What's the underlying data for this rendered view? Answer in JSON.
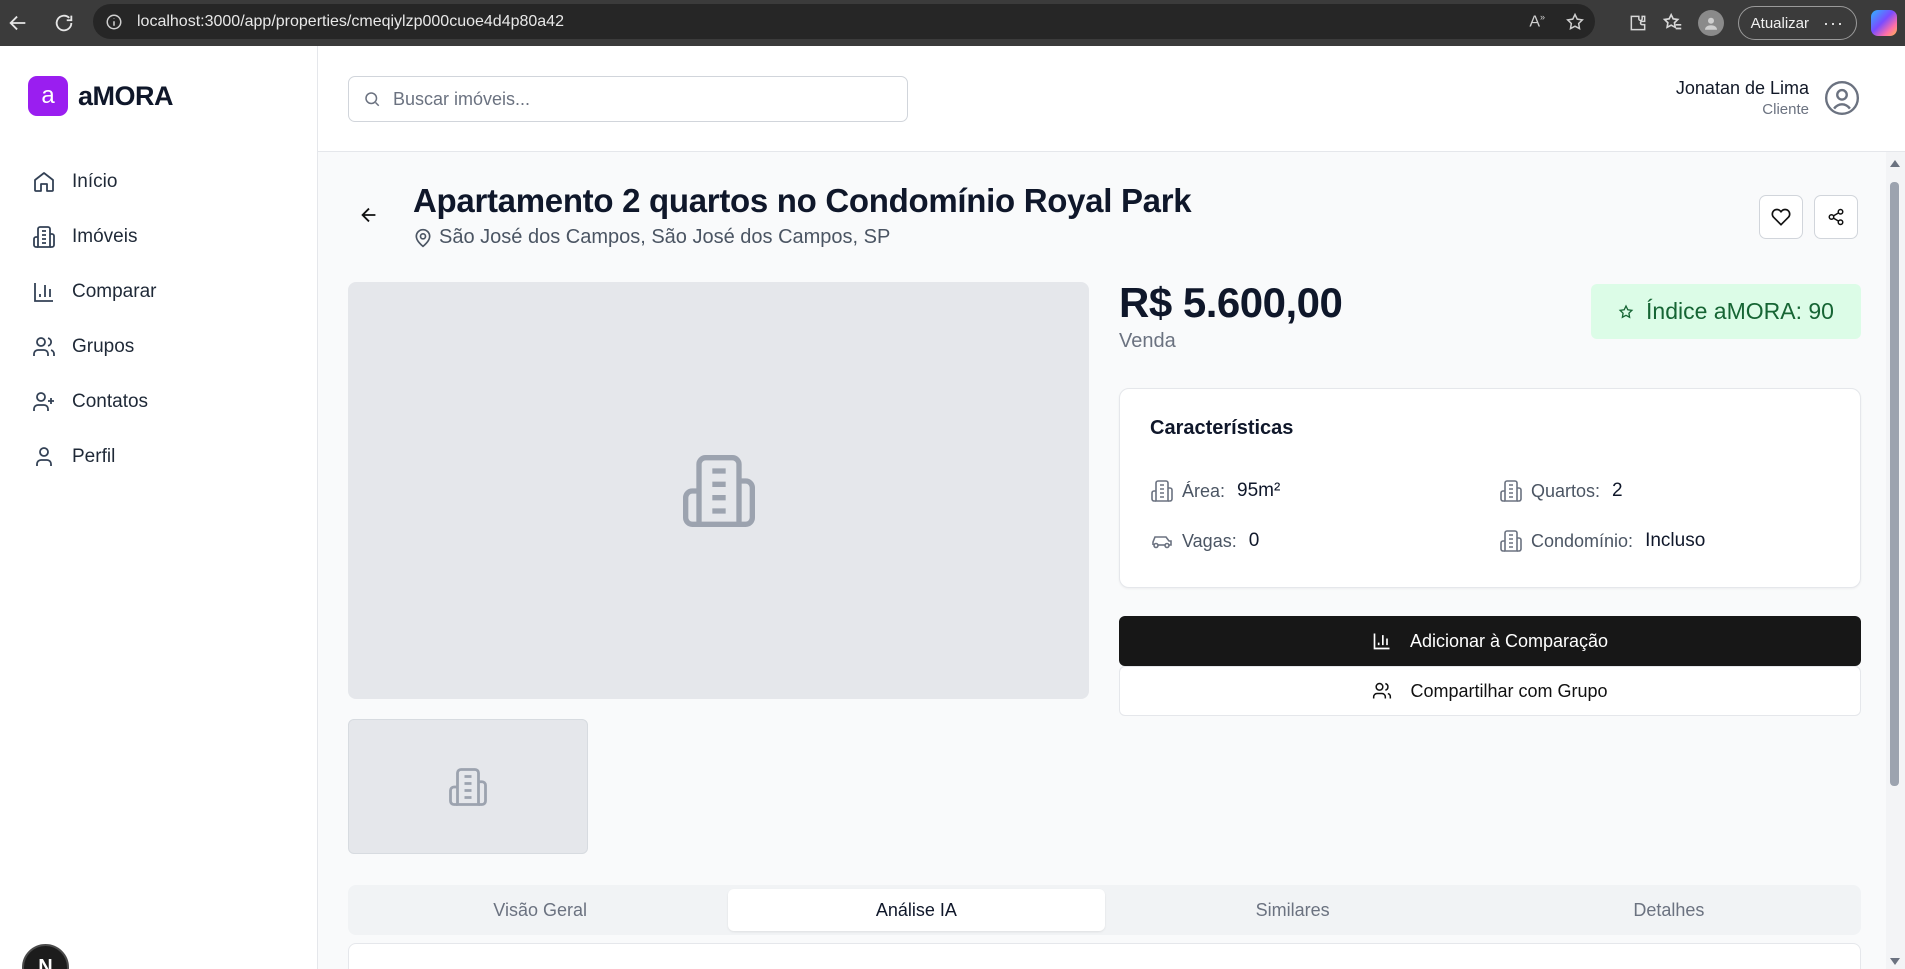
{
  "browser": {
    "url": "localhost:3000/app/properties/cmeqiylzp000cuoe4d4p80a42",
    "update_label": "Atualizar"
  },
  "brand": {
    "logo_letter": "a",
    "name": "aMORA",
    "accent": "#9a1ef0"
  },
  "sidebar": {
    "items": [
      {
        "label": "Início",
        "icon": "home-icon"
      },
      {
        "label": "Imóveis",
        "icon": "building-icon"
      },
      {
        "label": "Comparar",
        "icon": "bar-chart-icon"
      },
      {
        "label": "Grupos",
        "icon": "users-icon"
      },
      {
        "label": "Contatos",
        "icon": "user-plus-icon"
      },
      {
        "label": "Perfil",
        "icon": "user-icon"
      }
    ],
    "dev_badge": "N"
  },
  "search": {
    "placeholder": "Buscar imóveis..."
  },
  "user": {
    "name": "Jonatan de Lima",
    "role": "Cliente"
  },
  "property": {
    "title": "Apartamento 2 quartos no Condomínio Royal Park",
    "location": "São José dos Campos, São José dos Campos, SP",
    "price": "R$ 5.600,00",
    "deal_type": "Venda",
    "score_label": "Índice aMORA: 90",
    "score_color": "#dcfce7"
  },
  "features": {
    "title": "Características",
    "items": [
      {
        "label": "Área:",
        "value": "95m²",
        "icon": "building-icon"
      },
      {
        "label": "Quartos:",
        "value": "2",
        "icon": "building-icon"
      },
      {
        "label": "Vagas:",
        "value": "0",
        "icon": "car-icon"
      },
      {
        "label": "Condomínio:",
        "value": "Incluso",
        "icon": "building-icon"
      }
    ]
  },
  "actions": {
    "compare_label": "Adicionar à Comparação",
    "share_label": "Compartilhar com Grupo"
  },
  "tabs": {
    "items": [
      "Visão Geral",
      "Análise IA",
      "Similares",
      "Detalhes"
    ],
    "active": "Análise IA"
  }
}
